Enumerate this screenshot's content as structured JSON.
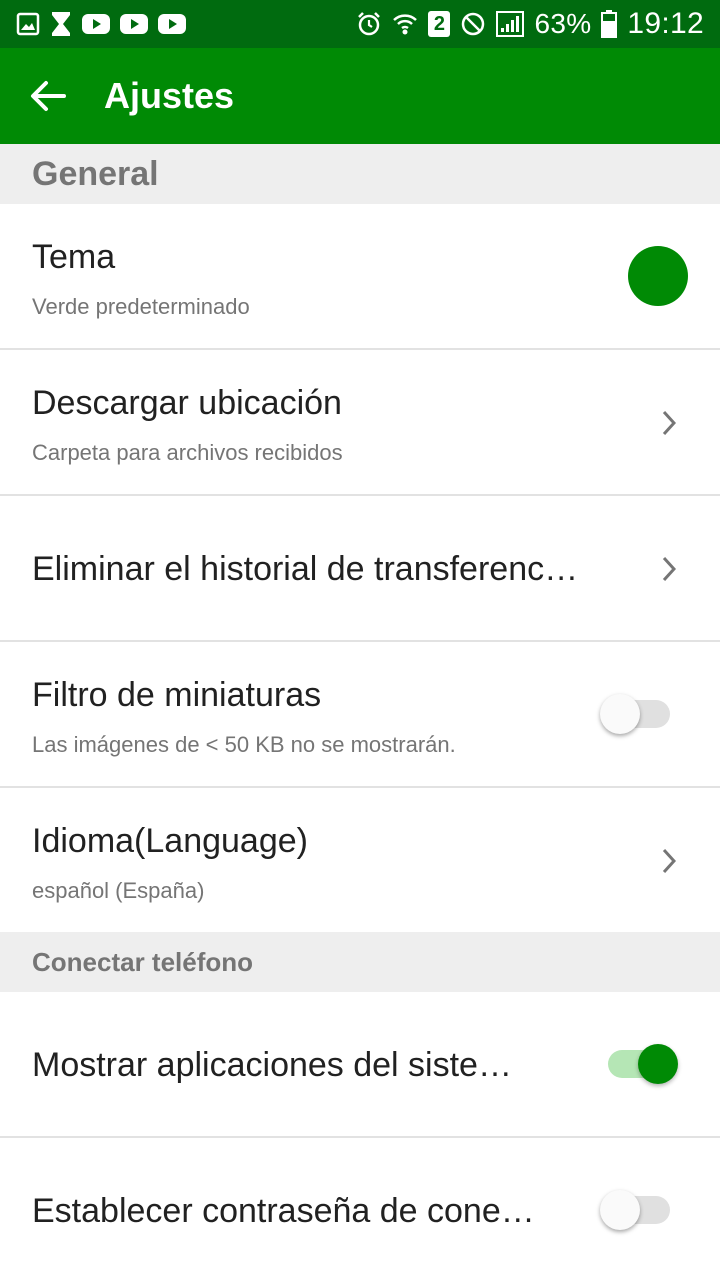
{
  "status_bar": {
    "battery": "63%",
    "time": "19:12",
    "sim_badge": "2"
  },
  "app_bar": {
    "title": "Ajustes",
    "background": "#008a05"
  },
  "sections": {
    "general": {
      "header": "General",
      "theme": {
        "title": "Tema",
        "subtitle": "Verde predeterminado",
        "color": "#008a05"
      },
      "download": {
        "title": "Descargar ubicación",
        "subtitle": "Carpeta para archivos recibidos"
      },
      "delete_history": {
        "title": "Eliminar el historial de transferenc…"
      },
      "thumbnail_filter": {
        "title": "Filtro de miniaturas",
        "subtitle": "Las imágenes de < 50 KB no se mostrarán.",
        "enabled": false
      },
      "language": {
        "title": "Idioma(Language)",
        "subtitle": "español (España)"
      }
    },
    "connect_phone": {
      "header": "Conectar teléfono",
      "show_system_apps": {
        "title": "Mostrar aplicaciones del siste…",
        "enabled": true
      },
      "set_password": {
        "title": "Establecer contraseña de cone…",
        "enabled": false
      }
    }
  }
}
